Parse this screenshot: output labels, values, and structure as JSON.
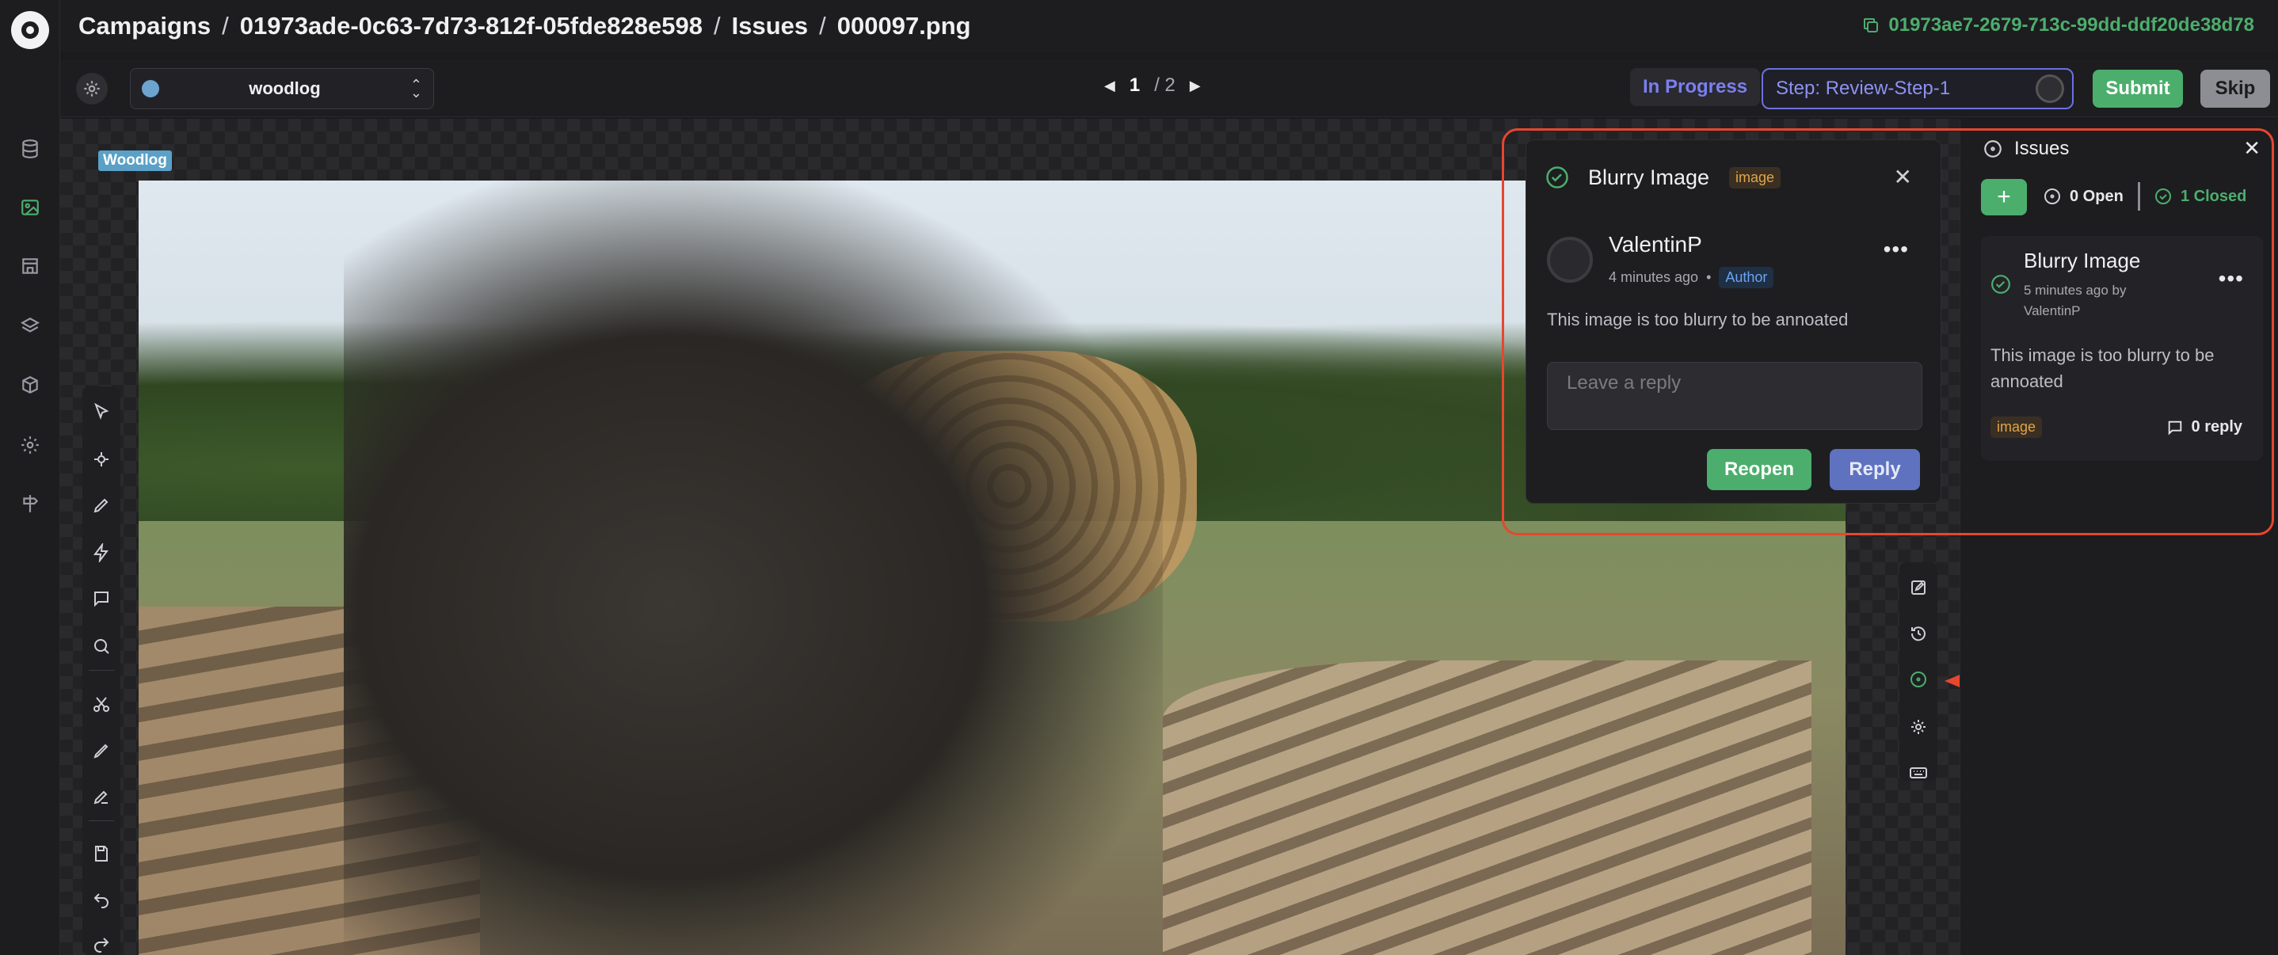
{
  "header": {
    "breadcrumb": [
      "Campaigns",
      "01973ade-0c63-7d73-812f-05fde828e598",
      "Issues",
      "000097.png"
    ],
    "separator": "/",
    "copy_id": "01973ae7-2679-713c-99dd-ddf20de38d78"
  },
  "toolbar": {
    "dataset": "woodlog",
    "page_current": "1",
    "page_total": "/ 2",
    "status": "In Progress",
    "step": "Step: Review-Step-1",
    "submit_label": "Submit",
    "skip_label": "Skip"
  },
  "canvas": {
    "label_tag": "Woodlog"
  },
  "issue_detail": {
    "title": "Blurry Image",
    "tag": "image",
    "user": "ValentinP",
    "time": "4 minutes ago",
    "bullet": "•",
    "role": "Author",
    "body": "This image is too blurry to be annoated",
    "reply_placeholder": "Leave a reply",
    "reopen_label": "Reopen",
    "reply_label": "Reply"
  },
  "issues_panel": {
    "title": "Issues",
    "open_count": "0 Open",
    "closed_count": "1 Closed",
    "issues": [
      {
        "title": "Blurry Image",
        "meta": "5 minutes ago by ValentinP",
        "body": "This image is too blurry to be annoated",
        "tag": "image",
        "replies": "0 reply"
      }
    ]
  },
  "colors": {
    "accent_green": "#4cae6c",
    "accent_purple": "#6c71e0",
    "highlight_red": "#e7462f"
  }
}
